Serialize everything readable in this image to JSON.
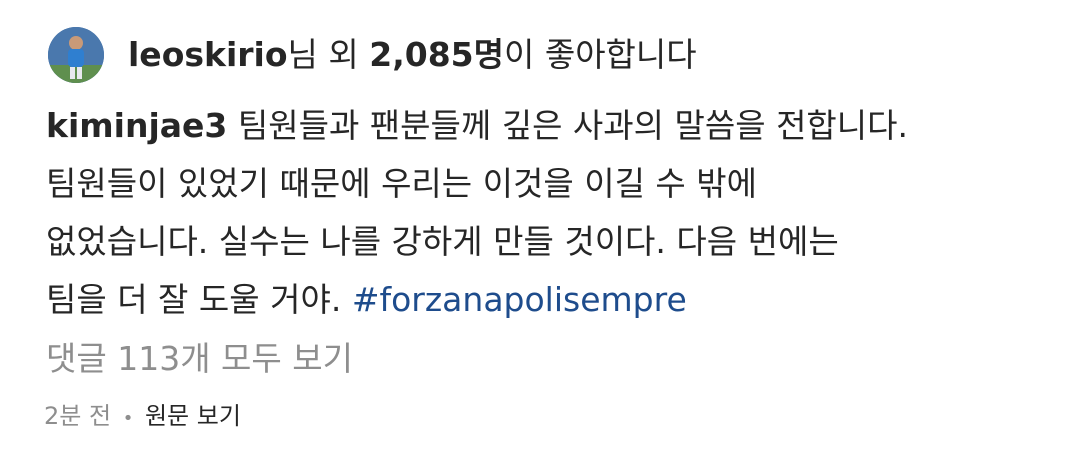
{
  "likes": {
    "avatar_icon": "profile-photo",
    "user": "leoskirio",
    "prefix_suffix": "님 외 ",
    "count": "2,085명",
    "suffix": "이 좋아합니다"
  },
  "caption": {
    "username": "kiminjae3",
    "line1_text": " 팀원들과 팬분들께 깊은 사과의 말씀을 전합니다.",
    "line2": "팀원들이 있었기 때문에 우리는 이것을 이길 수 밖에",
    "line3": "없었습니다. 실수는 나를 강하게 만들 것이다. 다음 번에는",
    "line4_text": "팀을 더 잘 도울 거야. ",
    "hashtag": "#forzanapolisempre",
    "hashtag_color": "#1e4c8c"
  },
  "comments": {
    "label": "댓글 113개 모두 보기"
  },
  "meta": {
    "time": "2분 전",
    "separator": "•",
    "translate_label": "원문 보기"
  }
}
